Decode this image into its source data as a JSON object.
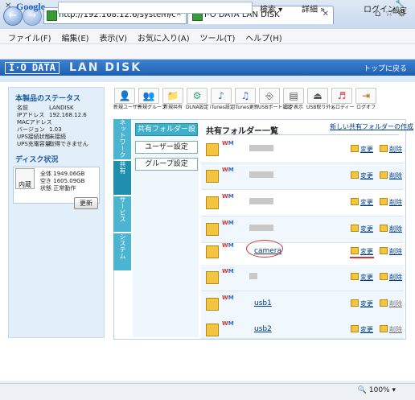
{
  "browser": {
    "address": "http://192.168.12.6/system/c",
    "tab_title": "I-O DATA LAN DISK",
    "menu": [
      "ファイル(F)",
      "編集(E)",
      "表示(V)",
      "お気に入り(A)",
      "ツール(T)",
      "ヘルプ(H)"
    ],
    "toolbar": {
      "google": "Google",
      "search": "検索 ▾",
      "detail": "詳細 »",
      "login": "ログイン",
      "settings": "設定"
    },
    "zoom": "100%"
  },
  "header": {
    "brand": "I·O DATA",
    "product": "LAN DISK",
    "top_link": "トップに戻る"
  },
  "status_panel": {
    "title": "本製品のステータス",
    "rows": [
      {
        "k": "名前",
        "v": "LANDISK"
      },
      {
        "k": "IPアドレス",
        "v": "192.168.12.6"
      },
      {
        "k": "MACアドレス",
        "v": ""
      },
      {
        "k": "バージョン",
        "v": "1.03"
      },
      {
        "k": "UPS接続状態",
        "v": "未接続"
      },
      {
        "k": "UPS充電容量",
        "v": "取得できません"
      }
    ],
    "disk_title": "ディスク状況",
    "disk_label": "内蔵",
    "disk_rows": [
      {
        "k": "全体",
        "v": "1949.06GB"
      },
      {
        "k": "空き",
        "v": "1605.09GB"
      },
      {
        "k": "状態",
        "v": "正常動作"
      }
    ],
    "update": "更新"
  },
  "toolbar_icons": [
    {
      "label": "新規ユーザー",
      "icon": "user-add-icon"
    },
    {
      "label": "新規グループ",
      "icon": "group-add-icon"
    },
    {
      "label": "新規共有",
      "icon": "share-add-icon"
    },
    {
      "label": "DLNA設定",
      "icon": "dlna-icon"
    },
    {
      "label": "iTunes設定",
      "icon": "itunes-settings-icon"
    },
    {
      "label": "iTunes更新",
      "icon": "itunes-update-icon"
    },
    {
      "label": "USBポート設定",
      "icon": "usb-port-icon"
    },
    {
      "label": "ログ表示",
      "icon": "log-icon"
    },
    {
      "label": "USB取り外し",
      "icon": "usb-remove-icon"
    },
    {
      "label": "メロディー",
      "icon": "melody-icon"
    },
    {
      "label": "ログオフ",
      "icon": "logoff-icon"
    }
  ],
  "side_tabs": [
    "ネットワーク",
    "共有",
    "サービス",
    "システム"
  ],
  "submenu": [
    "共有フォルダー設定",
    "ユーザー設定",
    "グループ設定"
  ],
  "list": {
    "title": "共有フォルダー一覧",
    "create": "新しい共有フォルダーの作成",
    "edit": "変更",
    "delete": "削除",
    "folders": [
      "",
      "",
      "",
      "",
      "camera",
      "",
      "usb1",
      "usb2"
    ]
  },
  "colors": {
    "brand_blue": "#1d5eb0",
    "tab_teal": "#3bb0c8",
    "annotation_red": "#d93030"
  }
}
